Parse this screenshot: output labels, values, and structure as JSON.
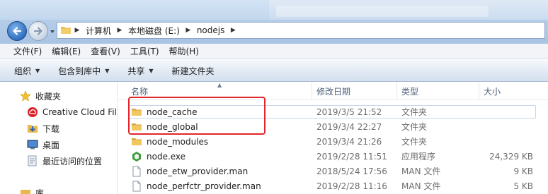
{
  "address": {
    "path": [
      "计算机",
      "本地磁盘 (E:)",
      "nodejs"
    ]
  },
  "menu": [
    "文件(F)",
    "编辑(E)",
    "查看(V)",
    "工具(T)",
    "帮助(H)"
  ],
  "toolbar": {
    "organize": "组织",
    "include_in_library": "包含到库中",
    "share": "共享",
    "new_folder": "新建文件夹"
  },
  "nav": {
    "favorites": "收藏夹",
    "creative_cloud": "Creative Cloud File",
    "downloads": "下载",
    "desktop": "桌面",
    "recent": "最近访问的位置",
    "libraries": "库"
  },
  "columns": {
    "name": "名称",
    "modified": "修改日期",
    "type": "类型",
    "size": "大小"
  },
  "files": [
    {
      "name": "node_cache",
      "date": "2019/3/5 21:52",
      "type": "文件夹",
      "size": "",
      "icon": "folder-icon"
    },
    {
      "name": "node_global",
      "date": "2019/3/4 22:27",
      "type": "文件夹",
      "size": "",
      "icon": "folder-icon"
    },
    {
      "name": "node_modules",
      "date": "2019/3/4 21:26",
      "type": "文件夹",
      "size": "",
      "icon": "folder-icon"
    },
    {
      "name": "node.exe",
      "date": "2019/2/28 11:51",
      "type": "应用程序",
      "size": "24,329 KB",
      "icon": "node-exe-icon"
    },
    {
      "name": "node_etw_provider.man",
      "date": "2018/5/24 17:56",
      "type": "MAN 文件",
      "size": "9 KB",
      "icon": "document-icon"
    },
    {
      "name": "node_perfctr_provider.man",
      "date": "2019/2/28 11:16",
      "type": "MAN 文件",
      "size": "5 KB",
      "icon": "document-icon"
    }
  ],
  "colors": {
    "highlight": "#e3262a",
    "folder": "#e8b84a"
  }
}
